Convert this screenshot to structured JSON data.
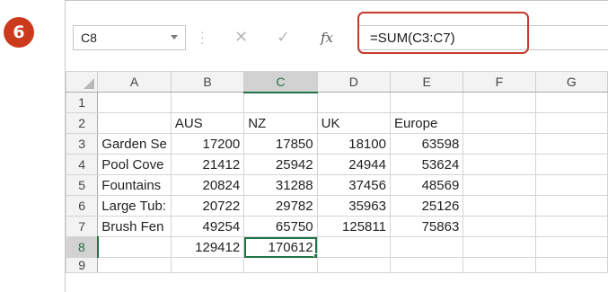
{
  "step_badge": "6",
  "name_box": "C8",
  "formula_bar": {
    "cancel_icon": "✕",
    "enter_icon": "✓",
    "fx_label": "fx",
    "formula": "=SUM(C3:C7)"
  },
  "columns": [
    "A",
    "B",
    "C",
    "D",
    "E",
    "F",
    "G"
  ],
  "selected_column": "C",
  "rows": [
    {
      "n": "1",
      "cells": [
        "",
        "",
        "",
        "",
        "",
        "",
        ""
      ]
    },
    {
      "n": "2",
      "cells": [
        "",
        "AUS",
        "NZ",
        "UK",
        "Europe",
        "",
        ""
      ]
    },
    {
      "n": "3",
      "cells": [
        "Garden Se",
        "17200",
        "17850",
        "18100",
        "63598",
        "",
        ""
      ]
    },
    {
      "n": "4",
      "cells": [
        "Pool Cove",
        "21412",
        "25942",
        "24944",
        "53624",
        "",
        ""
      ]
    },
    {
      "n": "5",
      "cells": [
        "Fountains",
        "20824",
        "31288",
        "37456",
        "48569",
        "",
        ""
      ]
    },
    {
      "n": "6",
      "cells": [
        "Large Tub:",
        "20722",
        "29782",
        "35963",
        "25126",
        "",
        ""
      ]
    },
    {
      "n": "7",
      "cells": [
        "Brush Fen",
        "49254",
        "65750",
        "125811",
        "75863",
        "",
        ""
      ]
    },
    {
      "n": "8",
      "cells": [
        "",
        "129412",
        "170612",
        "",
        "",
        "",
        ""
      ]
    },
    {
      "n": "9",
      "cells": [
        "",
        "",
        "",
        "",
        "",
        "",
        ""
      ]
    }
  ],
  "active_cell": {
    "row": "8",
    "col": "C"
  },
  "colors": {
    "badge": "#cc3a1e",
    "highlight": "#c43b2b",
    "excel_green": "#217346"
  }
}
